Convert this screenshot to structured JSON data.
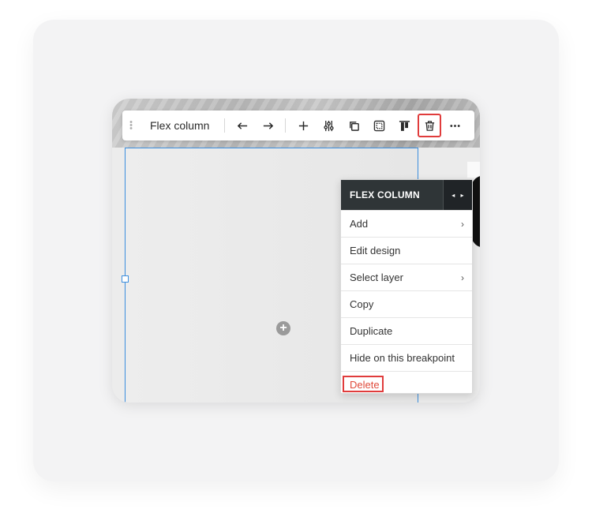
{
  "toolbar": {
    "title": "Flex column",
    "icons": [
      "drag-handle-icon",
      "arrow-left-icon",
      "arrow-right-icon",
      "plus-icon",
      "sliders-icon",
      "duplicate-icon",
      "frame-icon",
      "align-top-icon",
      "trash-icon",
      "more-icon"
    ]
  },
  "canvas": {
    "add_glyph": "+"
  },
  "context_menu": {
    "header": "FLEX COLUMN",
    "nav_prev": "◂",
    "nav_next": "▸",
    "items": [
      {
        "label": "Add",
        "has_submenu": true
      },
      {
        "label": "Edit design",
        "has_submenu": false
      },
      {
        "label": "Select layer",
        "has_submenu": true
      },
      {
        "label": "Copy",
        "has_submenu": false
      },
      {
        "label": "Duplicate",
        "has_submenu": false
      },
      {
        "label": "Hide on this breakpoint",
        "has_submenu": false
      },
      {
        "label": "Delete",
        "has_submenu": false
      }
    ],
    "chevron": "›"
  },
  "colors": {
    "selection_blue": "#3b8ede",
    "highlight_red": "#e03c3c",
    "delete_text": "#e04a3a",
    "menu_header_bg": "#2f3537"
  }
}
